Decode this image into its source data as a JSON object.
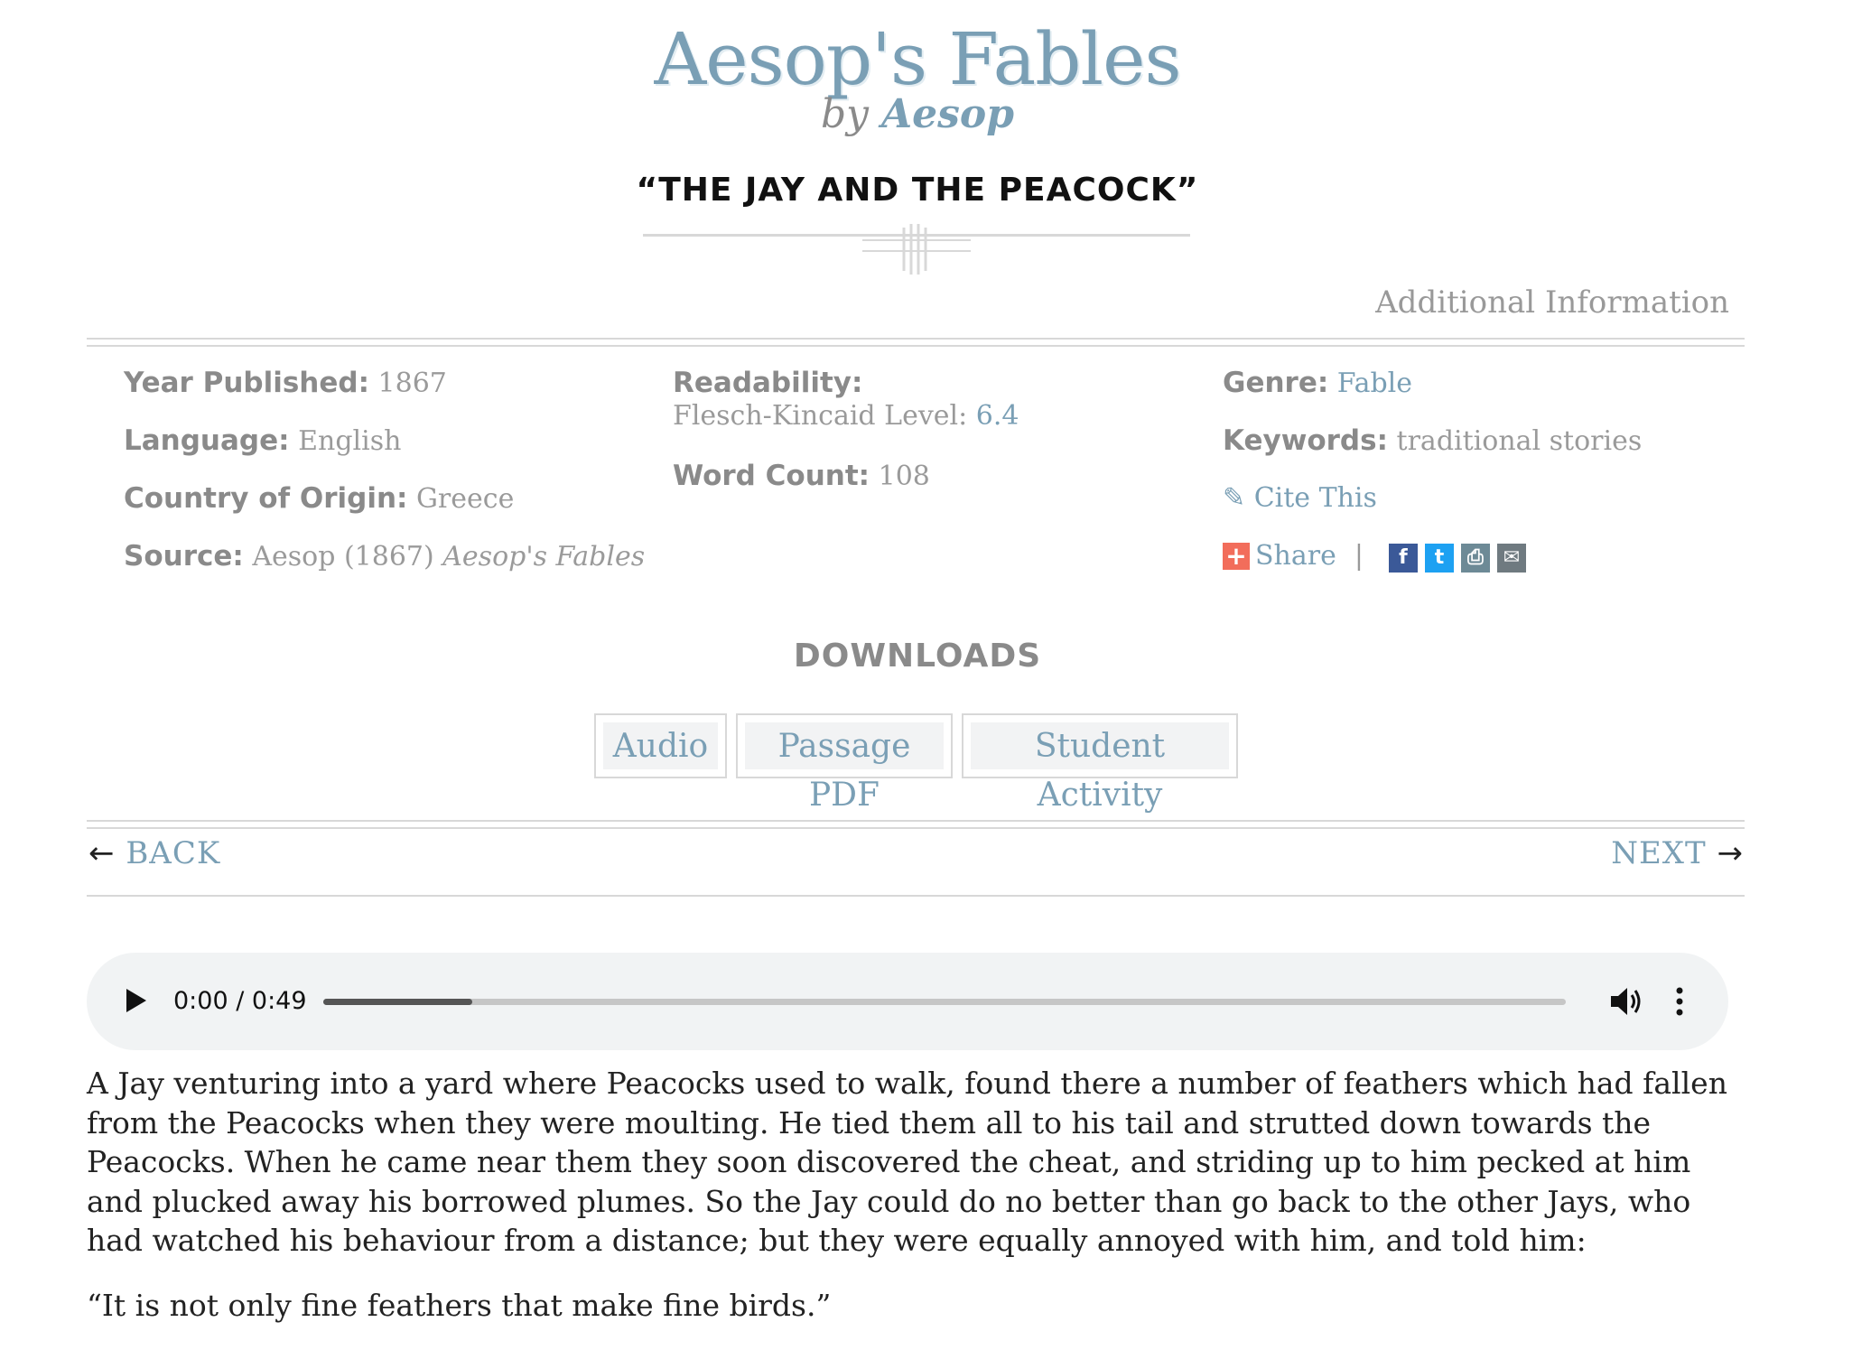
{
  "header": {
    "book_title": "Aesop's Fables",
    "by": "by",
    "author": "Aesop",
    "story_title": "“THE JAY AND THE PEACOCK”"
  },
  "additional_info_label": "Additional Information",
  "meta": {
    "year_published": {
      "label": "Year Published:",
      "value": "1867"
    },
    "language": {
      "label": "Language:",
      "value": "English"
    },
    "country": {
      "label": "Country of Origin:",
      "value": "Greece"
    },
    "source": {
      "label": "Source:",
      "value": "Aesop (1867)",
      "title": "Aesop's Fables"
    },
    "readability": {
      "label": "Readability:",
      "sub_label": "Flesch-Kincaid Level:",
      "value": "6.4"
    },
    "word_count": {
      "label": "Word Count:",
      "value": "108"
    },
    "genre": {
      "label": "Genre:",
      "value": "Fable"
    },
    "keywords": {
      "label": "Keywords:",
      "value": "traditional stories"
    },
    "cite": {
      "icon": "pencil-icon",
      "label": "Cite This"
    },
    "share": {
      "plus": "+",
      "label": "Share",
      "separator": "|"
    }
  },
  "social_icons": [
    {
      "name": "facebook-icon",
      "glyph": "f",
      "color": "#3b5998"
    },
    {
      "name": "twitter-icon",
      "glyph": "t",
      "color": "#1da1f2"
    },
    {
      "name": "print-icon",
      "glyph": "⎙",
      "color": "#6d8a96"
    },
    {
      "name": "email-icon",
      "glyph": "✉",
      "color": "#6f7a80"
    }
  ],
  "downloads": {
    "heading": "DOWNLOADS",
    "buttons": [
      "Audio",
      "Passage PDF",
      "Student Activity"
    ]
  },
  "nav": {
    "back": "BACK",
    "next": "NEXT",
    "back_arrow": "←",
    "next_arrow": "→"
  },
  "audio": {
    "time": "0:00 / 0:49",
    "progress_fraction": 0.12
  },
  "passage": {
    "paragraphs": [
      "A Jay venturing into a yard where Peacocks used to walk, found there a number of feathers which had fallen from the Peacocks when they were moulting. He tied them all to his tail and strutted down towards the Peacocks. When he came near them they soon discovered the cheat, and striding up to him pecked at him and plucked away his borrowed plumes. So the Jay could do no better than go back to the other Jays, who had watched his behaviour from a distance; but they were equally annoyed with him, and told him:",
      "“It is not only fine feathers that make fine birds.”"
    ]
  },
  "colors": {
    "accent": "#7a9fb5",
    "muted": "#999999",
    "rule": "#d8d8d8"
  }
}
